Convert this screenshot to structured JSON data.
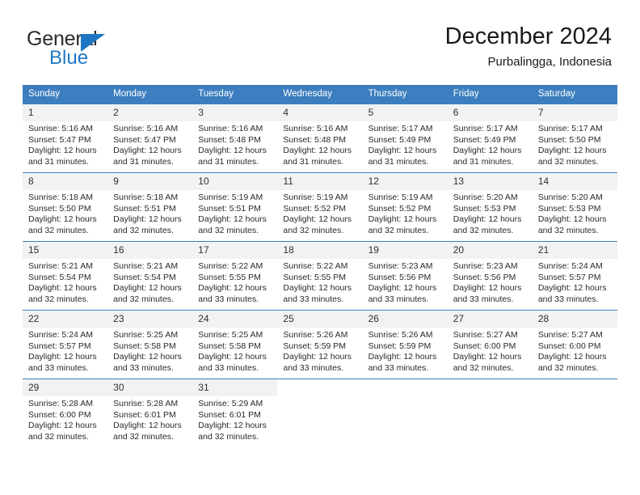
{
  "brand": {
    "name_top": "General",
    "name_bottom": "Blue",
    "triangle_icon": "blue-triangle-icon",
    "color_blue": "#1f77c4",
    "color_dark": "#2b2b2b"
  },
  "header": {
    "title": "December 2024",
    "subtitle": "Purbalingga, Indonesia"
  },
  "theme": {
    "header_bg": "#3c7ebf",
    "header_text": "#ffffff",
    "daynum_bg": "#f2f2f2",
    "grid_line": "#3c7ebf"
  },
  "weekdays": [
    "Sunday",
    "Monday",
    "Tuesday",
    "Wednesday",
    "Thursday",
    "Friday",
    "Saturday"
  ],
  "labels": {
    "sunrise_prefix": "Sunrise:",
    "sunset_prefix": "Sunset:",
    "daylight_prefix": "Daylight:"
  },
  "weeks": [
    [
      {
        "day": "1",
        "sunrise": "Sunrise: 5:16 AM",
        "sunset": "Sunset: 5:47 PM",
        "daylight": "Daylight: 12 hours and 31 minutes."
      },
      {
        "day": "2",
        "sunrise": "Sunrise: 5:16 AM",
        "sunset": "Sunset: 5:47 PM",
        "daylight": "Daylight: 12 hours and 31 minutes."
      },
      {
        "day": "3",
        "sunrise": "Sunrise: 5:16 AM",
        "sunset": "Sunset: 5:48 PM",
        "daylight": "Daylight: 12 hours and 31 minutes."
      },
      {
        "day": "4",
        "sunrise": "Sunrise: 5:16 AM",
        "sunset": "Sunset: 5:48 PM",
        "daylight": "Daylight: 12 hours and 31 minutes."
      },
      {
        "day": "5",
        "sunrise": "Sunrise: 5:17 AM",
        "sunset": "Sunset: 5:49 PM",
        "daylight": "Daylight: 12 hours and 31 minutes."
      },
      {
        "day": "6",
        "sunrise": "Sunrise: 5:17 AM",
        "sunset": "Sunset: 5:49 PM",
        "daylight": "Daylight: 12 hours and 31 minutes."
      },
      {
        "day": "7",
        "sunrise": "Sunrise: 5:17 AM",
        "sunset": "Sunset: 5:50 PM",
        "daylight": "Daylight: 12 hours and 32 minutes."
      }
    ],
    [
      {
        "day": "8",
        "sunrise": "Sunrise: 5:18 AM",
        "sunset": "Sunset: 5:50 PM",
        "daylight": "Daylight: 12 hours and 32 minutes."
      },
      {
        "day": "9",
        "sunrise": "Sunrise: 5:18 AM",
        "sunset": "Sunset: 5:51 PM",
        "daylight": "Daylight: 12 hours and 32 minutes."
      },
      {
        "day": "10",
        "sunrise": "Sunrise: 5:19 AM",
        "sunset": "Sunset: 5:51 PM",
        "daylight": "Daylight: 12 hours and 32 minutes."
      },
      {
        "day": "11",
        "sunrise": "Sunrise: 5:19 AM",
        "sunset": "Sunset: 5:52 PM",
        "daylight": "Daylight: 12 hours and 32 minutes."
      },
      {
        "day": "12",
        "sunrise": "Sunrise: 5:19 AM",
        "sunset": "Sunset: 5:52 PM",
        "daylight": "Daylight: 12 hours and 32 minutes."
      },
      {
        "day": "13",
        "sunrise": "Sunrise: 5:20 AM",
        "sunset": "Sunset: 5:53 PM",
        "daylight": "Daylight: 12 hours and 32 minutes."
      },
      {
        "day": "14",
        "sunrise": "Sunrise: 5:20 AM",
        "sunset": "Sunset: 5:53 PM",
        "daylight": "Daylight: 12 hours and 32 minutes."
      }
    ],
    [
      {
        "day": "15",
        "sunrise": "Sunrise: 5:21 AM",
        "sunset": "Sunset: 5:54 PM",
        "daylight": "Daylight: 12 hours and 32 minutes."
      },
      {
        "day": "16",
        "sunrise": "Sunrise: 5:21 AM",
        "sunset": "Sunset: 5:54 PM",
        "daylight": "Daylight: 12 hours and 32 minutes."
      },
      {
        "day": "17",
        "sunrise": "Sunrise: 5:22 AM",
        "sunset": "Sunset: 5:55 PM",
        "daylight": "Daylight: 12 hours and 33 minutes."
      },
      {
        "day": "18",
        "sunrise": "Sunrise: 5:22 AM",
        "sunset": "Sunset: 5:55 PM",
        "daylight": "Daylight: 12 hours and 33 minutes."
      },
      {
        "day": "19",
        "sunrise": "Sunrise: 5:23 AM",
        "sunset": "Sunset: 5:56 PM",
        "daylight": "Daylight: 12 hours and 33 minutes."
      },
      {
        "day": "20",
        "sunrise": "Sunrise: 5:23 AM",
        "sunset": "Sunset: 5:56 PM",
        "daylight": "Daylight: 12 hours and 33 minutes."
      },
      {
        "day": "21",
        "sunrise": "Sunrise: 5:24 AM",
        "sunset": "Sunset: 5:57 PM",
        "daylight": "Daylight: 12 hours and 33 minutes."
      }
    ],
    [
      {
        "day": "22",
        "sunrise": "Sunrise: 5:24 AM",
        "sunset": "Sunset: 5:57 PM",
        "daylight": "Daylight: 12 hours and 33 minutes."
      },
      {
        "day": "23",
        "sunrise": "Sunrise: 5:25 AM",
        "sunset": "Sunset: 5:58 PM",
        "daylight": "Daylight: 12 hours and 33 minutes."
      },
      {
        "day": "24",
        "sunrise": "Sunrise: 5:25 AM",
        "sunset": "Sunset: 5:58 PM",
        "daylight": "Daylight: 12 hours and 33 minutes."
      },
      {
        "day": "25",
        "sunrise": "Sunrise: 5:26 AM",
        "sunset": "Sunset: 5:59 PM",
        "daylight": "Daylight: 12 hours and 33 minutes."
      },
      {
        "day": "26",
        "sunrise": "Sunrise: 5:26 AM",
        "sunset": "Sunset: 5:59 PM",
        "daylight": "Daylight: 12 hours and 33 minutes."
      },
      {
        "day": "27",
        "sunrise": "Sunrise: 5:27 AM",
        "sunset": "Sunset: 6:00 PM",
        "daylight": "Daylight: 12 hours and 32 minutes."
      },
      {
        "day": "28",
        "sunrise": "Sunrise: 5:27 AM",
        "sunset": "Sunset: 6:00 PM",
        "daylight": "Daylight: 12 hours and 32 minutes."
      }
    ],
    [
      {
        "day": "29",
        "sunrise": "Sunrise: 5:28 AM",
        "sunset": "Sunset: 6:00 PM",
        "daylight": "Daylight: 12 hours and 32 minutes."
      },
      {
        "day": "30",
        "sunrise": "Sunrise: 5:28 AM",
        "sunset": "Sunset: 6:01 PM",
        "daylight": "Daylight: 12 hours and 32 minutes."
      },
      {
        "day": "31",
        "sunrise": "Sunrise: 5:29 AM",
        "sunset": "Sunset: 6:01 PM",
        "daylight": "Daylight: 12 hours and 32 minutes."
      },
      {
        "day": "",
        "sunrise": "",
        "sunset": "",
        "daylight": ""
      },
      {
        "day": "",
        "sunrise": "",
        "sunset": "",
        "daylight": ""
      },
      {
        "day": "",
        "sunrise": "",
        "sunset": "",
        "daylight": ""
      },
      {
        "day": "",
        "sunrise": "",
        "sunset": "",
        "daylight": ""
      }
    ]
  ]
}
